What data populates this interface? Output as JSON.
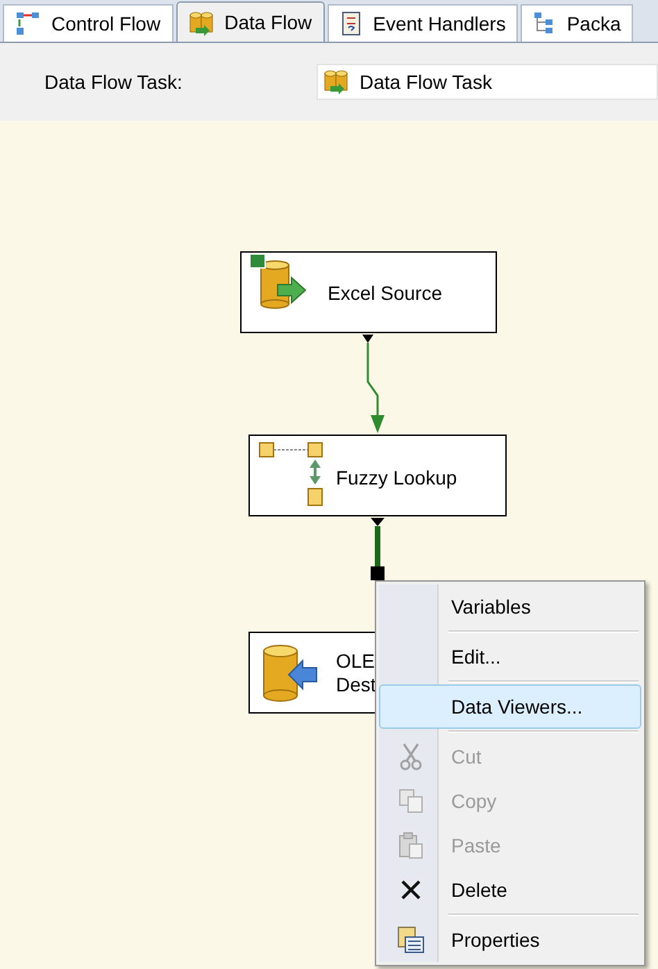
{
  "tabs": [
    {
      "label": "Control Flow",
      "selected": false
    },
    {
      "label": "Data Flow",
      "selected": true
    },
    {
      "label": "Event Handlers",
      "selected": false
    },
    {
      "label": "Packa",
      "selected": false
    }
  ],
  "toolbar": {
    "label": "Data Flow Task:",
    "task_select": {
      "value": "Data Flow Task"
    }
  },
  "nodes": [
    {
      "kind": "source",
      "label_lines": [
        "Excel Source"
      ]
    },
    {
      "kind": "transform",
      "label_lines": [
        "Fuzzy Lookup"
      ]
    },
    {
      "kind": "destination",
      "label_lines": [
        "OLE",
        "Dest"
      ]
    }
  ],
  "context_menu": {
    "items": [
      {
        "kind": "plain",
        "label": "Variables",
        "selected": false,
        "disabled": false,
        "separator_after": true
      },
      {
        "kind": "plain",
        "label": "Edit...",
        "selected": false,
        "disabled": false,
        "separator_after": true
      },
      {
        "kind": "plain",
        "label": "Data Viewers...",
        "selected": true,
        "disabled": false,
        "separator_after": true
      },
      {
        "kind": "cut",
        "label": "Cut",
        "selected": false,
        "disabled": true,
        "separator_after": false
      },
      {
        "kind": "copy",
        "label": "Copy",
        "selected": false,
        "disabled": true,
        "separator_after": false
      },
      {
        "kind": "paste",
        "label": "Paste",
        "selected": false,
        "disabled": true,
        "separator_after": false
      },
      {
        "kind": "delete",
        "label": "Delete",
        "selected": false,
        "disabled": false,
        "separator_after": true
      },
      {
        "kind": "properties",
        "label": "Properties",
        "selected": false,
        "disabled": false,
        "separator_after": false
      }
    ]
  }
}
